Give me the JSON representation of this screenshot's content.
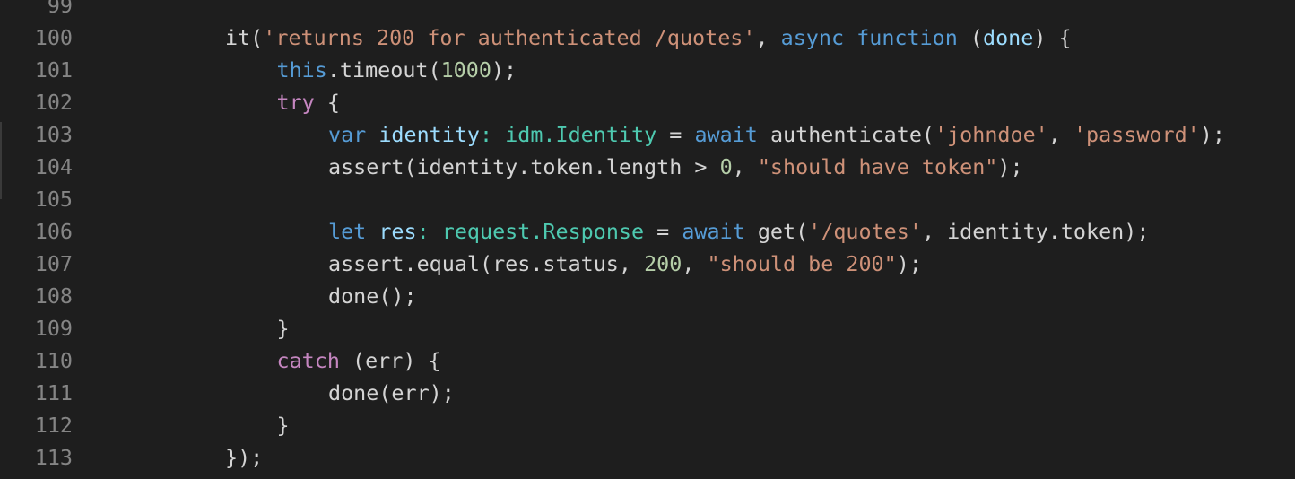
{
  "editor": {
    "colors": {
      "background": "#1e1e1e",
      "line_number": "#858585",
      "plain": "#d4d4d4",
      "string": "#ce9178",
      "keyword": "#569cd6",
      "control": "#c586c0",
      "variable": "#9cdcfe",
      "type": "#4ec9b0",
      "number": "#b5cea8",
      "function": "#dcdcaa"
    },
    "lines": [
      {
        "number": "99",
        "indent": 0,
        "tokens": []
      },
      {
        "number": "100",
        "indent": 2,
        "tokens": [
          {
            "text": "it(",
            "kind": "plain"
          },
          {
            "text": "'returns 200 for authenticated /quotes'",
            "kind": "string"
          },
          {
            "text": ", ",
            "kind": "plain"
          },
          {
            "text": "async",
            "kind": "keyword"
          },
          {
            "text": " ",
            "kind": "plain"
          },
          {
            "text": "function",
            "kind": "keyword"
          },
          {
            "text": " (",
            "kind": "plain"
          },
          {
            "text": "done",
            "kind": "variable"
          },
          {
            "text": ") {",
            "kind": "plain"
          }
        ]
      },
      {
        "number": "101",
        "indent": 3,
        "tokens": [
          {
            "text": "this",
            "kind": "keyword"
          },
          {
            "text": ".timeout(",
            "kind": "plain"
          },
          {
            "text": "1000",
            "kind": "number"
          },
          {
            "text": ");",
            "kind": "plain"
          }
        ]
      },
      {
        "number": "102",
        "indent": 3,
        "tokens": [
          {
            "text": "try",
            "kind": "control"
          },
          {
            "text": " {",
            "kind": "plain"
          }
        ]
      },
      {
        "number": "103",
        "indent": 4,
        "tokens": [
          {
            "text": "var",
            "kind": "keyword"
          },
          {
            "text": " ",
            "kind": "plain"
          },
          {
            "text": "identity",
            "kind": "variable"
          },
          {
            "text": ": ",
            "kind": "type"
          },
          {
            "text": "idm.Identity",
            "kind": "type"
          },
          {
            "text": " = ",
            "kind": "plain"
          },
          {
            "text": "await",
            "kind": "keyword"
          },
          {
            "text": " authenticate(",
            "kind": "plain"
          },
          {
            "text": "'johndoe'",
            "kind": "string"
          },
          {
            "text": ", ",
            "kind": "plain"
          },
          {
            "text": "'password'",
            "kind": "string"
          },
          {
            "text": ");",
            "kind": "plain"
          }
        ]
      },
      {
        "number": "104",
        "indent": 4,
        "tokens": [
          {
            "text": "assert(identity.token.length > ",
            "kind": "plain"
          },
          {
            "text": "0",
            "kind": "number"
          },
          {
            "text": ", ",
            "kind": "plain"
          },
          {
            "text": "\"should have token\"",
            "kind": "string"
          },
          {
            "text": ");",
            "kind": "plain"
          }
        ]
      },
      {
        "number": "105",
        "indent": 0,
        "tokens": []
      },
      {
        "number": "106",
        "indent": 4,
        "tokens": [
          {
            "text": "let",
            "kind": "keyword"
          },
          {
            "text": " ",
            "kind": "plain"
          },
          {
            "text": "res",
            "kind": "variable"
          },
          {
            "text": ": ",
            "kind": "type"
          },
          {
            "text": "request.Response",
            "kind": "type"
          },
          {
            "text": " = ",
            "kind": "plain"
          },
          {
            "text": "await",
            "kind": "keyword"
          },
          {
            "text": " get(",
            "kind": "plain"
          },
          {
            "text": "'/quotes'",
            "kind": "string"
          },
          {
            "text": ", identity.token);",
            "kind": "plain"
          }
        ]
      },
      {
        "number": "107",
        "indent": 4,
        "tokens": [
          {
            "text": "assert.equal(res.status, ",
            "kind": "plain"
          },
          {
            "text": "200",
            "kind": "number"
          },
          {
            "text": ", ",
            "kind": "plain"
          },
          {
            "text": "\"should be 200\"",
            "kind": "string"
          },
          {
            "text": ");",
            "kind": "plain"
          }
        ]
      },
      {
        "number": "108",
        "indent": 4,
        "tokens": [
          {
            "text": "done();",
            "kind": "plain"
          }
        ]
      },
      {
        "number": "109",
        "indent": 3,
        "tokens": [
          {
            "text": "}",
            "kind": "plain"
          }
        ]
      },
      {
        "number": "110",
        "indent": 3,
        "tokens": [
          {
            "text": "catch",
            "kind": "control"
          },
          {
            "text": " (err) {",
            "kind": "plain"
          }
        ]
      },
      {
        "number": "111",
        "indent": 4,
        "tokens": [
          {
            "text": "done(err);",
            "kind": "plain"
          }
        ]
      },
      {
        "number": "112",
        "indent": 3,
        "tokens": [
          {
            "text": "}",
            "kind": "plain"
          }
        ]
      },
      {
        "number": "113",
        "indent": 2,
        "tokens": [
          {
            "text": "});",
            "kind": "plain"
          }
        ]
      }
    ]
  }
}
